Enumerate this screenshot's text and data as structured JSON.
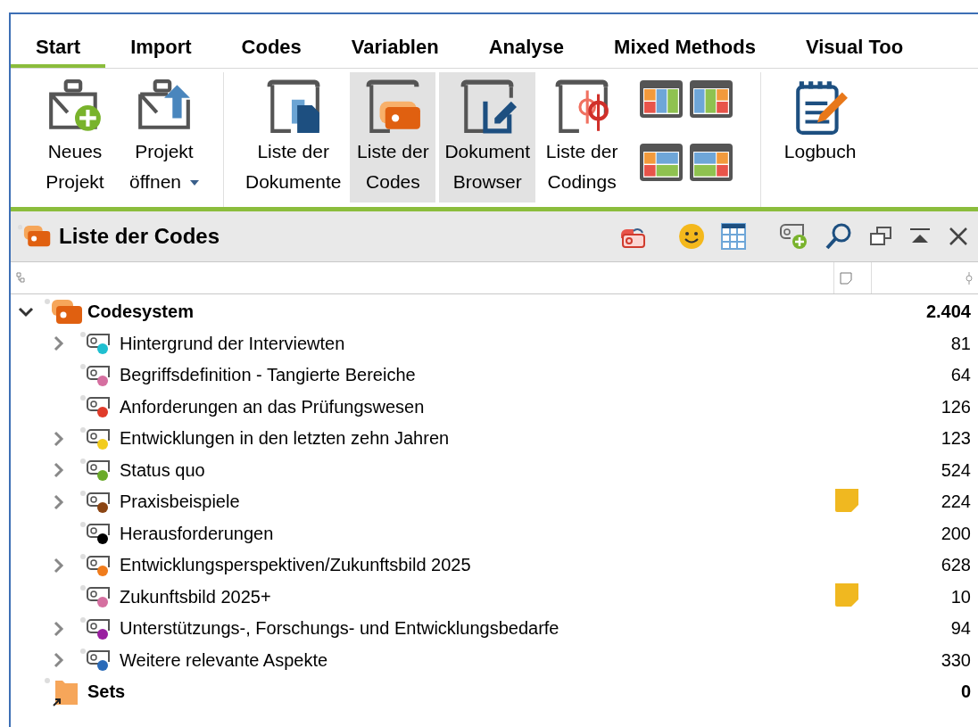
{
  "tabs": [
    {
      "label": "Start",
      "selected": true
    },
    {
      "label": "Import",
      "selected": false
    },
    {
      "label": "Codes",
      "selected": false
    },
    {
      "label": "Variablen",
      "selected": false
    },
    {
      "label": "Analyse",
      "selected": false
    },
    {
      "label": "Mixed Methods",
      "selected": false
    },
    {
      "label": "Visual Too",
      "selected": false
    }
  ],
  "ribbon_groups": [
    {
      "buttons": [
        {
          "kind": "new-project",
          "lines": [
            "Neues",
            "Projekt"
          ],
          "selected": false,
          "dropdown": false
        },
        {
          "kind": "open-project",
          "lines": [
            "Projekt",
            "öffnen"
          ],
          "selected": false,
          "dropdown": true
        }
      ]
    },
    {
      "buttons": [
        {
          "kind": "documents",
          "lines": [
            "Liste der",
            "Dokumente"
          ],
          "selected": false,
          "dropdown": false
        },
        {
          "kind": "codes",
          "lines": [
            "Liste der",
            "Codes"
          ],
          "selected": true,
          "dropdown": false
        },
        {
          "kind": "browser",
          "lines": [
            "Dokument",
            "Browser"
          ],
          "selected": true,
          "dropdown": false
        },
        {
          "kind": "codings",
          "lines": [
            "Liste der",
            "Codings"
          ],
          "selected": false,
          "dropdown": false
        },
        {
          "kind": "layouts"
        }
      ]
    },
    {
      "buttons": [
        {
          "kind": "logbook",
          "lines": [
            "Logbuch"
          ],
          "selected": false,
          "dropdown": false
        }
      ]
    }
  ],
  "panel": {
    "title": "Liste der Codes"
  },
  "tree": [
    {
      "kind": "codesystem",
      "label": "Codesystem",
      "count": "2.404",
      "expanded": true,
      "children": [
        {
          "label": "Hintergrund der Interviewten",
          "count": "81",
          "color": "#1fbfd0",
          "has_subcodes": true,
          "memo": false
        },
        {
          "label": "Begriffsdefinition - Tangierte Bereiche",
          "count": "64",
          "color": "#d56fa0",
          "has_subcodes": false,
          "memo": false
        },
        {
          "label": "Anforderungen an das Prüfungswesen",
          "count": "126",
          "color": "#e03b2a",
          "has_subcodes": false,
          "memo": false
        },
        {
          "label": "Entwicklungen in den letzten zehn Jahren",
          "count": "123",
          "color": "#f2cc1c",
          "has_subcodes": true,
          "memo": false
        },
        {
          "label": "Status quo",
          "count": "524",
          "color": "#6aaa2a",
          "has_subcodes": true,
          "memo": false
        },
        {
          "label": "Praxisbeispiele",
          "count": "224",
          "color": "#8b4513",
          "has_subcodes": true,
          "memo": true
        },
        {
          "label": "Herausforderungen",
          "count": "200",
          "color": "#000000",
          "has_subcodes": false,
          "memo": false
        },
        {
          "label": "Entwicklungsperspektiven/Zukunftsbild 2025",
          "count": "628",
          "color": "#f07c1c",
          "has_subcodes": true,
          "memo": false
        },
        {
          "label": "Zukunftsbild 2025+",
          "count": "10",
          "color": "#d56fa0",
          "has_subcodes": false,
          "memo": true
        },
        {
          "label": "Unterstützungs-, Forschungs- und Entwicklungsbedarfe",
          "count": "94",
          "color": "#9a1fa0",
          "has_subcodes": true,
          "memo": false
        },
        {
          "label": "Weitere relevante Aspekte",
          "count": "330",
          "color": "#2a6ab8",
          "has_subcodes": true,
          "memo": false
        }
      ]
    },
    {
      "kind": "sets",
      "label": "Sets",
      "count": "0"
    }
  ]
}
